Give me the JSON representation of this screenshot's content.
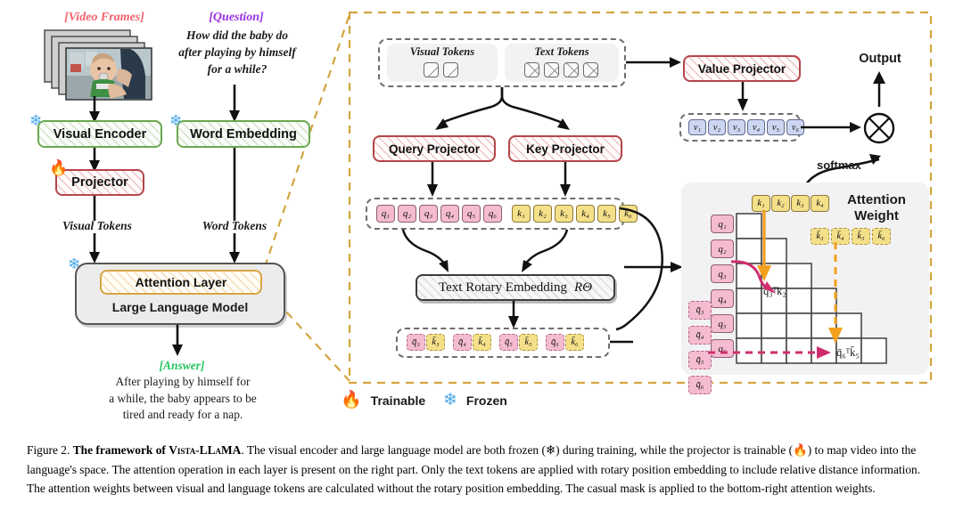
{
  "figure": {
    "number": "Figure 2.",
    "title_bold": "The framework of ",
    "title_sc": "Vista-LLaMA",
    "caption_rest": ". The visual encoder and large language model are both frozen (❄) during training, while the projector is trainable (🔥) to map video into the language's space. The attention operation in each layer is present on the right part. Only the text tokens are applied with rotary position embedding to include relative distance information. The attention weights between visual and language tokens are calculated without the rotary position embedding. The casual mask is applied to the bottom-right attention weights."
  },
  "left_panel": {
    "video_frames_label": "[Video Frames]",
    "question_label": "[Question]",
    "question_text_lines": [
      "How did the baby do",
      "after playing by himself",
      "for a while?"
    ],
    "visual_encoder": "Visual Encoder",
    "word_embedding": "Word Embedding",
    "projector": "Projector",
    "visual_tokens_label": "Visual Tokens",
    "word_tokens_label": "Word Tokens",
    "attention_layer": "Attention Layer",
    "large_language_model": "Large Language Model",
    "answer_label": "[Answer]",
    "answer_text_lines": [
      "After playing by himself for",
      "a while, the baby appears to be",
      "tired and ready for a nap."
    ]
  },
  "right_panel": {
    "visual_tokens_label": "Visual Tokens",
    "text_tokens_label": "Text Tokens",
    "visual_token_count": 2,
    "text_token_count": 4,
    "query_projector": "Query Projector",
    "key_projector": "Key Projector",
    "value_projector": "Value Projector",
    "rotary_embedding": "Text Rotary Embedding",
    "rotary_embedding_sym": "RΘ",
    "q_tokens": [
      "q₁",
      "q₂",
      "q₃",
      "q₄",
      "q₅",
      "q₆"
    ],
    "k_tokens": [
      "k₁",
      "k₂",
      "k₃",
      "k₄",
      "k₅",
      "k₆"
    ],
    "v_tokens": [
      "v₁",
      "v₂",
      "v₃",
      "v₄",
      "v₅",
      "v₆"
    ],
    "rotary_pairs": [
      {
        "q": "q̄₃",
        "k": "k̄₃"
      },
      {
        "q": "q̄₄",
        "k": "k̄₄"
      },
      {
        "q": "q̄₅",
        "k": "k̄₅"
      },
      {
        "q": "q̄₆",
        "k": "k̄₆"
      }
    ],
    "output_label": "Output",
    "softmax_label": "softmax",
    "multiply_symbol": "⊗"
  },
  "attention": {
    "title_line1": "Attention",
    "title_line2": "Weight",
    "col_keys_plain": [
      "k₁",
      "k₂",
      "k₃",
      "k₄"
    ],
    "col_keys_rotary": [
      "k̄₃",
      "k̄₄",
      "k̄₅",
      "k̄₆"
    ],
    "row_queries_plain": [
      "q₁",
      "q₂",
      "q₃",
      "q₄",
      "q₅",
      "q₆"
    ],
    "row_queries_rotary": [
      "q̄₃",
      "q̄₄",
      "q̄₅",
      "q̄₆"
    ],
    "cell_label_plain_q": "q",
    "cell_label_plain_sub": "3",
    "cell_label_plain_k": "k",
    "cell_label_plain_ksub": "2",
    "cell_formula_1": "q₃ᵀk₂",
    "cell_formula_2": "q̄₆ᵀk̄₅",
    "grid_rows": 6,
    "mask_type": "lower-triangular-casual-mask"
  },
  "legend": {
    "trainable_label": "Trainable",
    "frozen_label": "Frozen",
    "trainable_icon": "flame-icon",
    "frozen_icon": "snowflake-icon"
  },
  "colors": {
    "video_frames_red": "#f4606c",
    "question_purple": "#9b30e0",
    "answer_green": "#22c55e",
    "encoder_green": "#6aa84f",
    "projector_red": "#b5454a",
    "attention_gold": "#d9a441",
    "q_pink": "#f5bbd0",
    "k_yellow": "#f5e08a",
    "v_blue": "#ccd6f0",
    "arrow_orange": "#f2a01e",
    "arrow_magenta": "#cf2e6e",
    "panel_dashed_gold": "#d2a53f"
  }
}
